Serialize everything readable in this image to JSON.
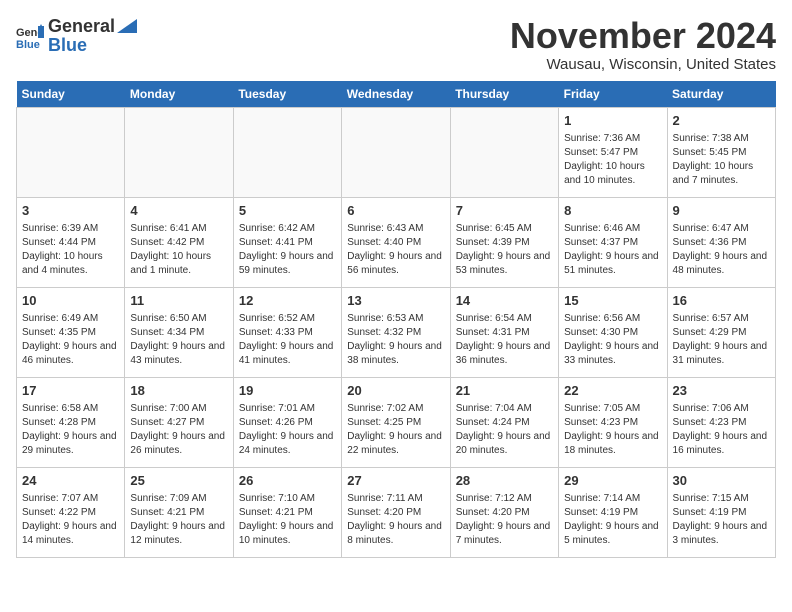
{
  "header": {
    "logo_line1": "General",
    "logo_line2": "Blue",
    "month_title": "November 2024",
    "location": "Wausau, Wisconsin, United States"
  },
  "days_of_week": [
    "Sunday",
    "Monday",
    "Tuesday",
    "Wednesday",
    "Thursday",
    "Friday",
    "Saturday"
  ],
  "weeks": [
    [
      {
        "day": null
      },
      {
        "day": null
      },
      {
        "day": null
      },
      {
        "day": null
      },
      {
        "day": null
      },
      {
        "day": "1",
        "sunrise": "Sunrise: 7:36 AM",
        "sunset": "Sunset: 5:47 PM",
        "daylight": "Daylight: 10 hours and 10 minutes."
      },
      {
        "day": "2",
        "sunrise": "Sunrise: 7:38 AM",
        "sunset": "Sunset: 5:45 PM",
        "daylight": "Daylight: 10 hours and 7 minutes."
      }
    ],
    [
      {
        "day": "3",
        "sunrise": "Sunrise: 6:39 AM",
        "sunset": "Sunset: 4:44 PM",
        "daylight": "Daylight: 10 hours and 4 minutes."
      },
      {
        "day": "4",
        "sunrise": "Sunrise: 6:41 AM",
        "sunset": "Sunset: 4:42 PM",
        "daylight": "Daylight: 10 hours and 1 minute."
      },
      {
        "day": "5",
        "sunrise": "Sunrise: 6:42 AM",
        "sunset": "Sunset: 4:41 PM",
        "daylight": "Daylight: 9 hours and 59 minutes."
      },
      {
        "day": "6",
        "sunrise": "Sunrise: 6:43 AM",
        "sunset": "Sunset: 4:40 PM",
        "daylight": "Daylight: 9 hours and 56 minutes."
      },
      {
        "day": "7",
        "sunrise": "Sunrise: 6:45 AM",
        "sunset": "Sunset: 4:39 PM",
        "daylight": "Daylight: 9 hours and 53 minutes."
      },
      {
        "day": "8",
        "sunrise": "Sunrise: 6:46 AM",
        "sunset": "Sunset: 4:37 PM",
        "daylight": "Daylight: 9 hours and 51 minutes."
      },
      {
        "day": "9",
        "sunrise": "Sunrise: 6:47 AM",
        "sunset": "Sunset: 4:36 PM",
        "daylight": "Daylight: 9 hours and 48 minutes."
      }
    ],
    [
      {
        "day": "10",
        "sunrise": "Sunrise: 6:49 AM",
        "sunset": "Sunset: 4:35 PM",
        "daylight": "Daylight: 9 hours and 46 minutes."
      },
      {
        "day": "11",
        "sunrise": "Sunrise: 6:50 AM",
        "sunset": "Sunset: 4:34 PM",
        "daylight": "Daylight: 9 hours and 43 minutes."
      },
      {
        "day": "12",
        "sunrise": "Sunrise: 6:52 AM",
        "sunset": "Sunset: 4:33 PM",
        "daylight": "Daylight: 9 hours and 41 minutes."
      },
      {
        "day": "13",
        "sunrise": "Sunrise: 6:53 AM",
        "sunset": "Sunset: 4:32 PM",
        "daylight": "Daylight: 9 hours and 38 minutes."
      },
      {
        "day": "14",
        "sunrise": "Sunrise: 6:54 AM",
        "sunset": "Sunset: 4:31 PM",
        "daylight": "Daylight: 9 hours and 36 minutes."
      },
      {
        "day": "15",
        "sunrise": "Sunrise: 6:56 AM",
        "sunset": "Sunset: 4:30 PM",
        "daylight": "Daylight: 9 hours and 33 minutes."
      },
      {
        "day": "16",
        "sunrise": "Sunrise: 6:57 AM",
        "sunset": "Sunset: 4:29 PM",
        "daylight": "Daylight: 9 hours and 31 minutes."
      }
    ],
    [
      {
        "day": "17",
        "sunrise": "Sunrise: 6:58 AM",
        "sunset": "Sunset: 4:28 PM",
        "daylight": "Daylight: 9 hours and 29 minutes."
      },
      {
        "day": "18",
        "sunrise": "Sunrise: 7:00 AM",
        "sunset": "Sunset: 4:27 PM",
        "daylight": "Daylight: 9 hours and 26 minutes."
      },
      {
        "day": "19",
        "sunrise": "Sunrise: 7:01 AM",
        "sunset": "Sunset: 4:26 PM",
        "daylight": "Daylight: 9 hours and 24 minutes."
      },
      {
        "day": "20",
        "sunrise": "Sunrise: 7:02 AM",
        "sunset": "Sunset: 4:25 PM",
        "daylight": "Daylight: 9 hours and 22 minutes."
      },
      {
        "day": "21",
        "sunrise": "Sunrise: 7:04 AM",
        "sunset": "Sunset: 4:24 PM",
        "daylight": "Daylight: 9 hours and 20 minutes."
      },
      {
        "day": "22",
        "sunrise": "Sunrise: 7:05 AM",
        "sunset": "Sunset: 4:23 PM",
        "daylight": "Daylight: 9 hours and 18 minutes."
      },
      {
        "day": "23",
        "sunrise": "Sunrise: 7:06 AM",
        "sunset": "Sunset: 4:23 PM",
        "daylight": "Daylight: 9 hours and 16 minutes."
      }
    ],
    [
      {
        "day": "24",
        "sunrise": "Sunrise: 7:07 AM",
        "sunset": "Sunset: 4:22 PM",
        "daylight": "Daylight: 9 hours and 14 minutes."
      },
      {
        "day": "25",
        "sunrise": "Sunrise: 7:09 AM",
        "sunset": "Sunset: 4:21 PM",
        "daylight": "Daylight: 9 hours and 12 minutes."
      },
      {
        "day": "26",
        "sunrise": "Sunrise: 7:10 AM",
        "sunset": "Sunset: 4:21 PM",
        "daylight": "Daylight: 9 hours and 10 minutes."
      },
      {
        "day": "27",
        "sunrise": "Sunrise: 7:11 AM",
        "sunset": "Sunset: 4:20 PM",
        "daylight": "Daylight: 9 hours and 8 minutes."
      },
      {
        "day": "28",
        "sunrise": "Sunrise: 7:12 AM",
        "sunset": "Sunset: 4:20 PM",
        "daylight": "Daylight: 9 hours and 7 minutes."
      },
      {
        "day": "29",
        "sunrise": "Sunrise: 7:14 AM",
        "sunset": "Sunset: 4:19 PM",
        "daylight": "Daylight: 9 hours and 5 minutes."
      },
      {
        "day": "30",
        "sunrise": "Sunrise: 7:15 AM",
        "sunset": "Sunset: 4:19 PM",
        "daylight": "Daylight: 9 hours and 3 minutes."
      }
    ]
  ]
}
